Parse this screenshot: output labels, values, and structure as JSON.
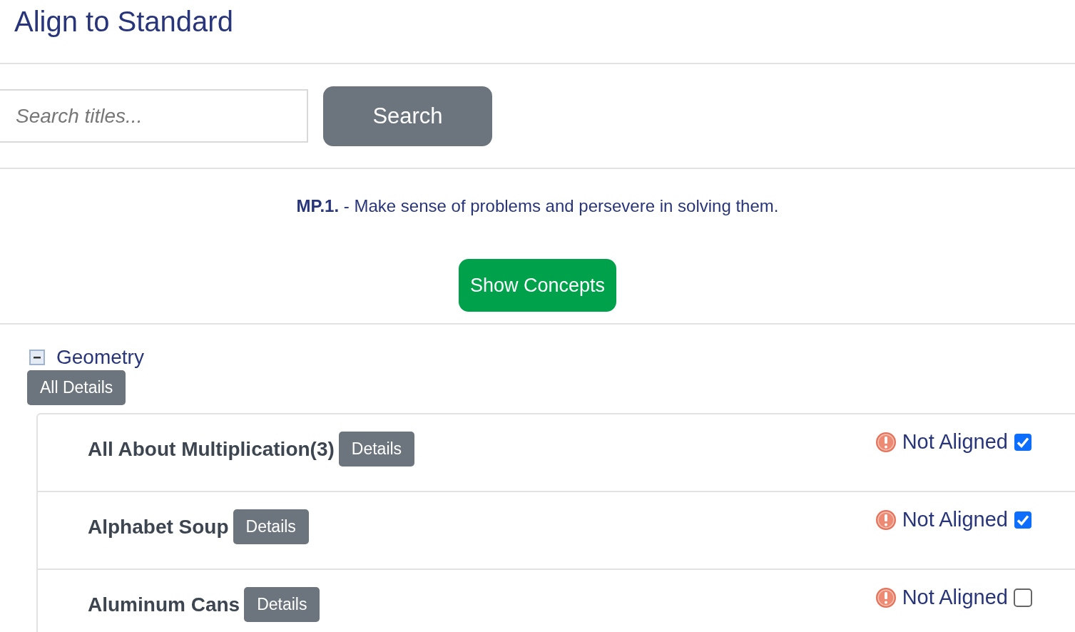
{
  "title": "Align to Standard",
  "search": {
    "placeholder": "Search titles...",
    "button": "Search"
  },
  "standard": {
    "code": "MP.1.",
    "text": "- Make sense of problems and persevere in solving them."
  },
  "show_concepts_button": "Show Concepts",
  "categories": [
    {
      "label": "Geometry",
      "expanded": true,
      "all_details_button": "All Details",
      "items": [
        {
          "title": "All About Multiplication(3)",
          "details_button": "Details",
          "status": "Not Aligned",
          "checked": true
        },
        {
          "title": "Alphabet Soup",
          "details_button": "Details",
          "status": "Not Aligned",
          "checked": true
        },
        {
          "title": "Aluminum Cans",
          "details_button": "Details",
          "status": "Not Aligned",
          "checked": false
        }
      ]
    }
  ]
}
